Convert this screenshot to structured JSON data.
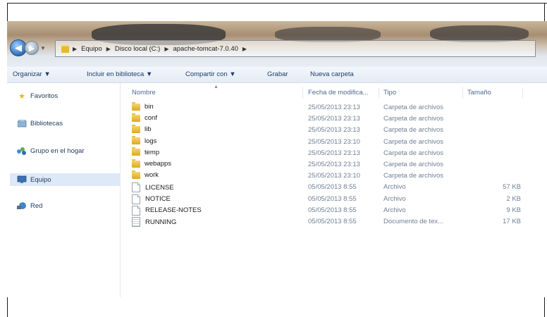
{
  "nav": {
    "back": "◀",
    "forward": "▶",
    "breadcrumbs": [
      "Equipo",
      "Disco local (C:)",
      "apache-tomcat-7.0.40"
    ],
    "separator": "▶"
  },
  "toolbar": {
    "organize": "Organizar ▼",
    "include": "Incluir en biblioteca ▼",
    "share": "Compartir con ▼",
    "burn": "Grabar",
    "new_folder": "Nueva carpeta"
  },
  "sidebar": {
    "items": [
      {
        "label": "Favoritos",
        "icon": "star-icon"
      },
      {
        "label": "Bibliotecas",
        "icon": "library-icon"
      },
      {
        "label": "Grupo en el hogar",
        "icon": "homegroup-icon"
      },
      {
        "label": "Equipo",
        "icon": "computer-icon",
        "selected": true
      },
      {
        "label": "Red",
        "icon": "network-icon"
      }
    ]
  },
  "columns": {
    "name": "Nombre",
    "date": "Fecha de modifica...",
    "type": "Tipo",
    "size": "Tamaño"
  },
  "files": [
    {
      "name": "bin",
      "date": "25/05/2013 23:13",
      "type": "Carpeta de archivos",
      "size": "",
      "kind": "folder"
    },
    {
      "name": "conf",
      "date": "25/05/2013 23:13",
      "type": "Carpeta de archivos",
      "size": "",
      "kind": "folder"
    },
    {
      "name": "lib",
      "date": "25/05/2013 23:13",
      "type": "Carpeta de archivos",
      "size": "",
      "kind": "folder"
    },
    {
      "name": "logs",
      "date": "25/05/2013 23:10",
      "type": "Carpeta de archivos",
      "size": "",
      "kind": "folder"
    },
    {
      "name": "temp",
      "date": "25/05/2013 23:13",
      "type": "Carpeta de archivos",
      "size": "",
      "kind": "folder"
    },
    {
      "name": "webapps",
      "date": "25/05/2013 23:13",
      "type": "Carpeta de archivos",
      "size": "",
      "kind": "folder"
    },
    {
      "name": "work",
      "date": "25/05/2013 23:10",
      "type": "Carpeta de archivos",
      "size": "",
      "kind": "folder"
    },
    {
      "name": "LICENSE",
      "date": "05/05/2013 8:55",
      "type": "Archivo",
      "size": "57 KB",
      "kind": "file"
    },
    {
      "name": "NOTICE",
      "date": "05/05/2013 8:55",
      "type": "Archivo",
      "size": "2 KB",
      "kind": "file"
    },
    {
      "name": "RELEASE-NOTES",
      "date": "05/05/2013 8:55",
      "type": "Archivo",
      "size": "9 KB",
      "kind": "file"
    },
    {
      "name": "RUNNING",
      "date": "05/05/2013 8:55",
      "type": "Documento de tex...",
      "size": "17 KB",
      "kind": "doc"
    }
  ]
}
